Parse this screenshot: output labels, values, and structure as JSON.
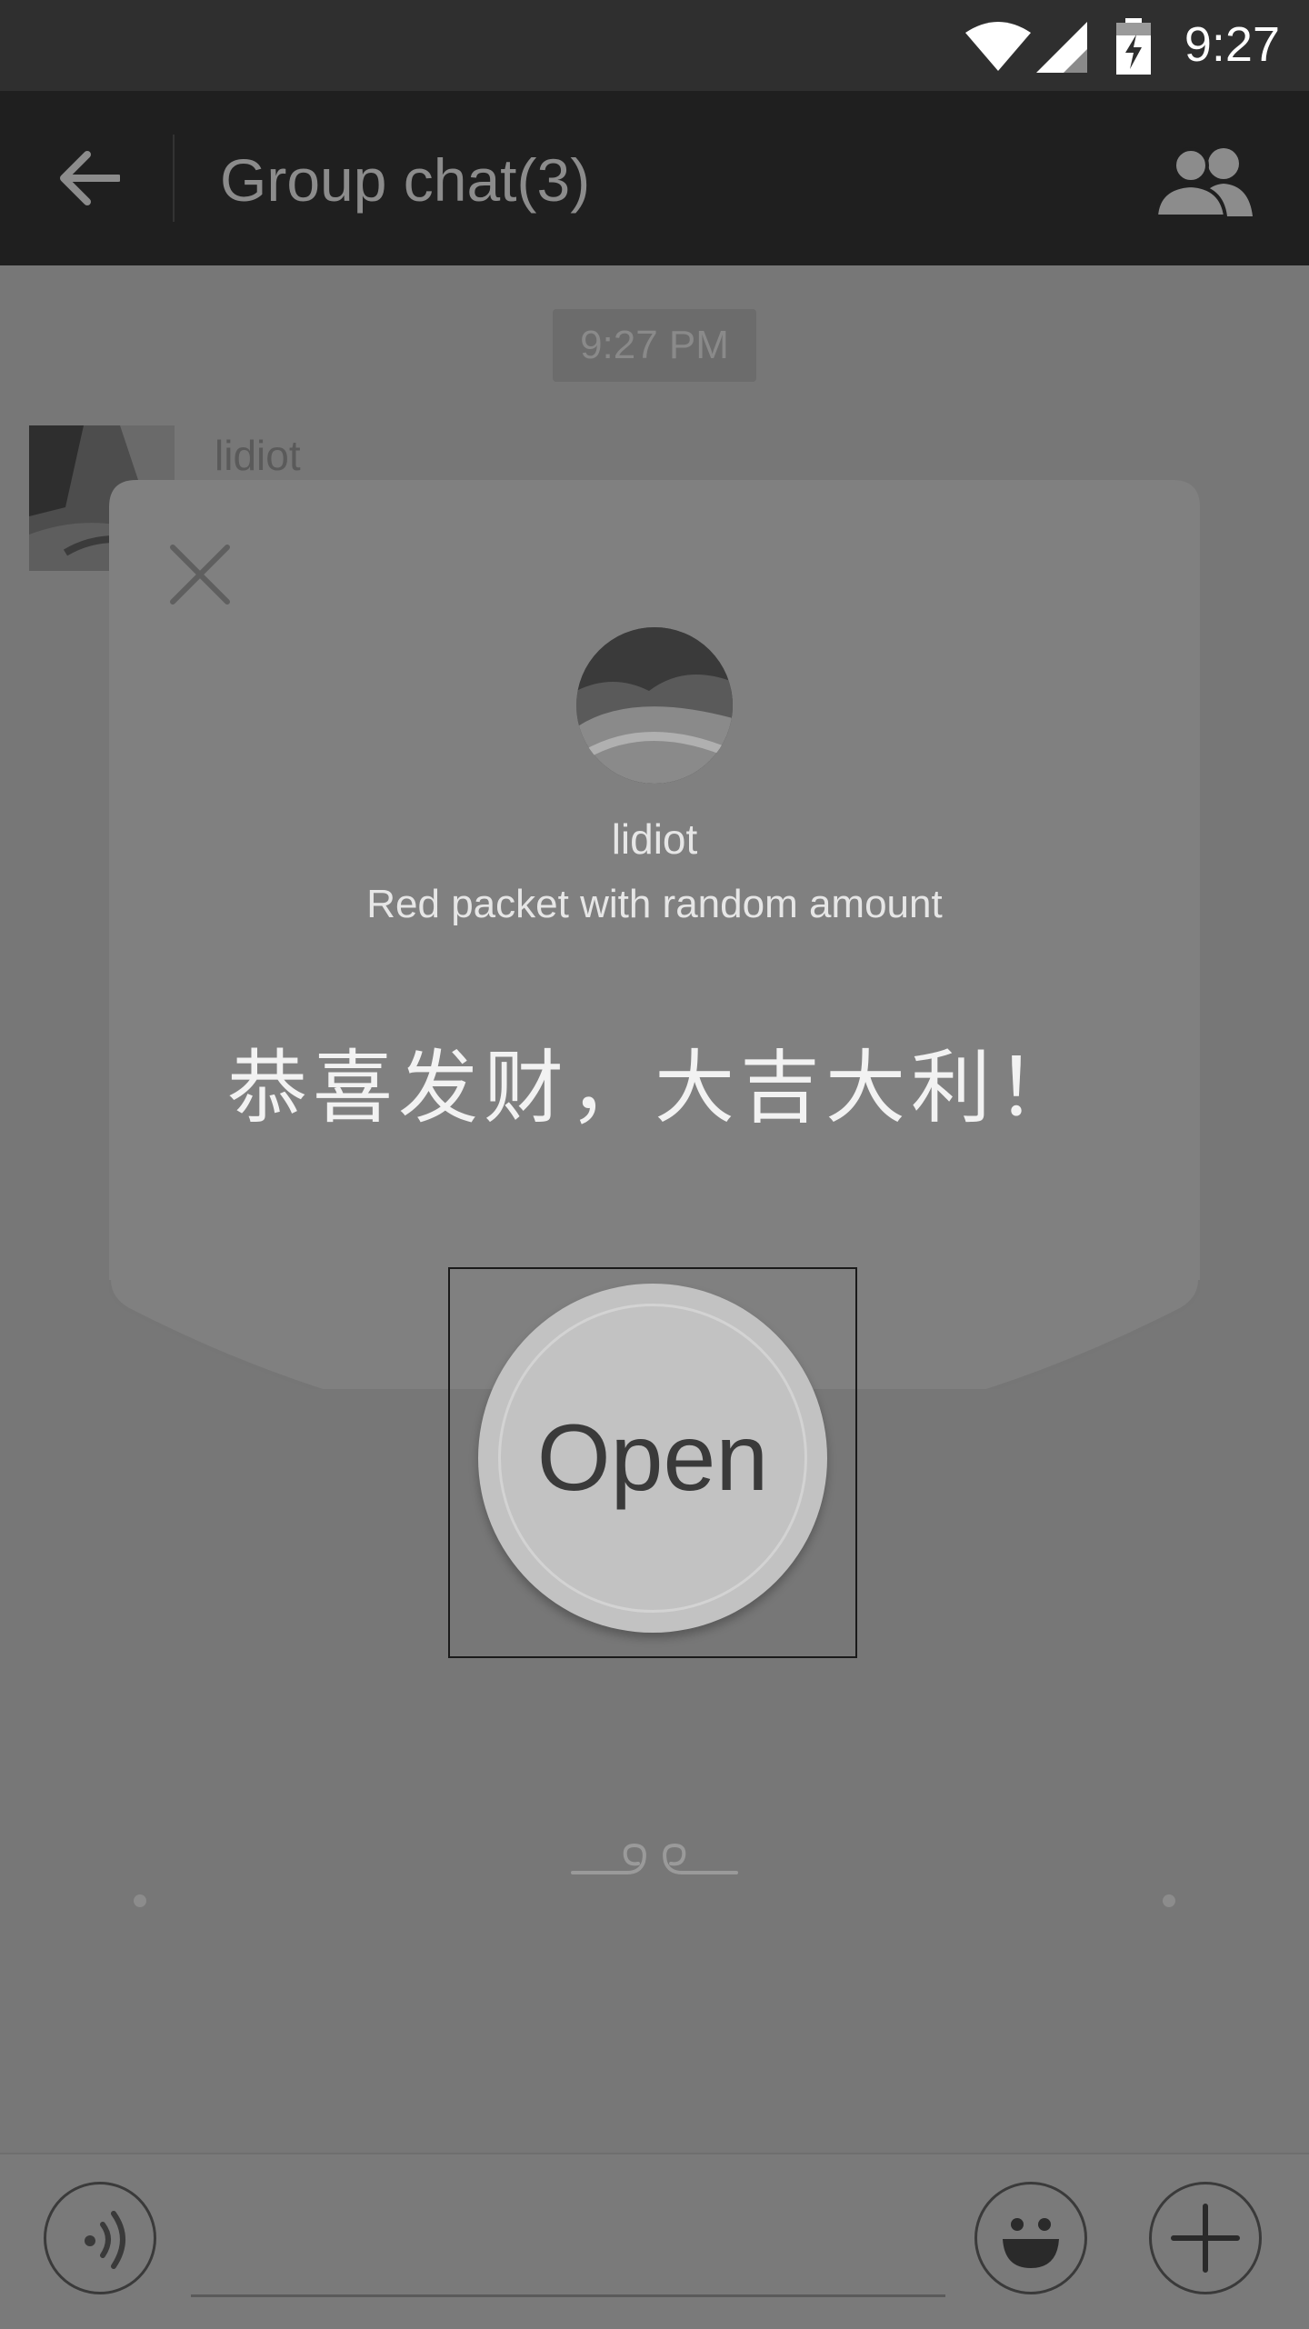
{
  "status_bar": {
    "time": "9:27",
    "icons": [
      "wifi-icon",
      "signal-icon",
      "battery-charging-icon"
    ]
  },
  "app_bar": {
    "title": "Group chat(3)",
    "back_icon": "arrow-left-icon",
    "members_icon": "group-icon"
  },
  "chat": {
    "timestamp": "9:27 PM",
    "sender": "lidiot"
  },
  "red_packet": {
    "sender": "lidiot",
    "description": "Red packet with random amount",
    "message": "恭喜发财，大吉大利！",
    "open_label": "Open"
  },
  "input_bar": {
    "icons": [
      "voice-icon",
      "emoji-icon",
      "plus-icon"
    ]
  },
  "colors": {
    "overlay": "#777777",
    "app_bar": "#1f1f1f",
    "status_bar": "#2f2f2f",
    "card": "#808080",
    "open_button": "#c2c2c2"
  }
}
